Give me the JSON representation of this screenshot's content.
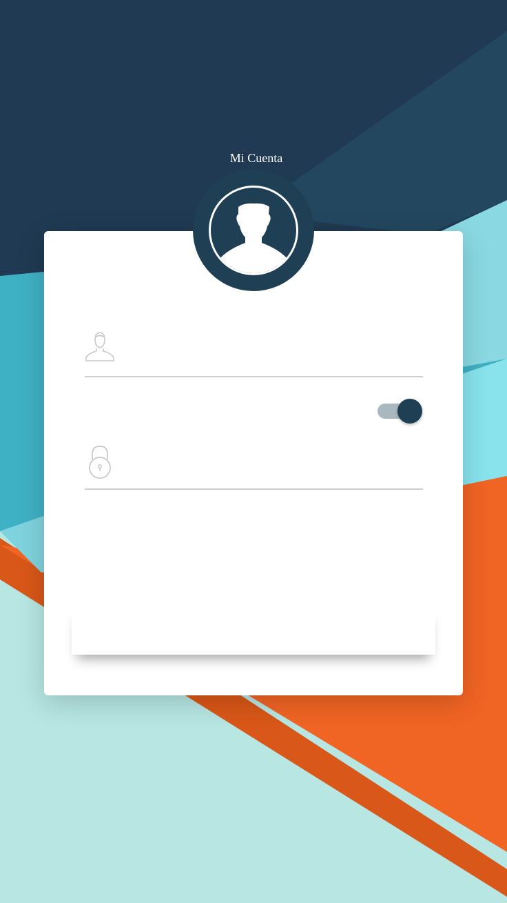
{
  "header": {
    "title": "Mi Cuenta"
  },
  "form": {
    "username": {
      "value": "",
      "placeholder": ""
    },
    "password": {
      "value": "",
      "placeholder": ""
    },
    "toggle": {
      "on": true
    }
  },
  "icons": {
    "avatar": "user-silhouette-icon",
    "username": "user-outline-icon",
    "password": "padlock-icon"
  },
  "colors": {
    "navy": "#1f3f55",
    "teal": "#3fb1c4",
    "light_teal": "#b7e6e3",
    "orange": "#f06424",
    "card": "#ffffff",
    "toggle_track": "#a9b7bf"
  }
}
